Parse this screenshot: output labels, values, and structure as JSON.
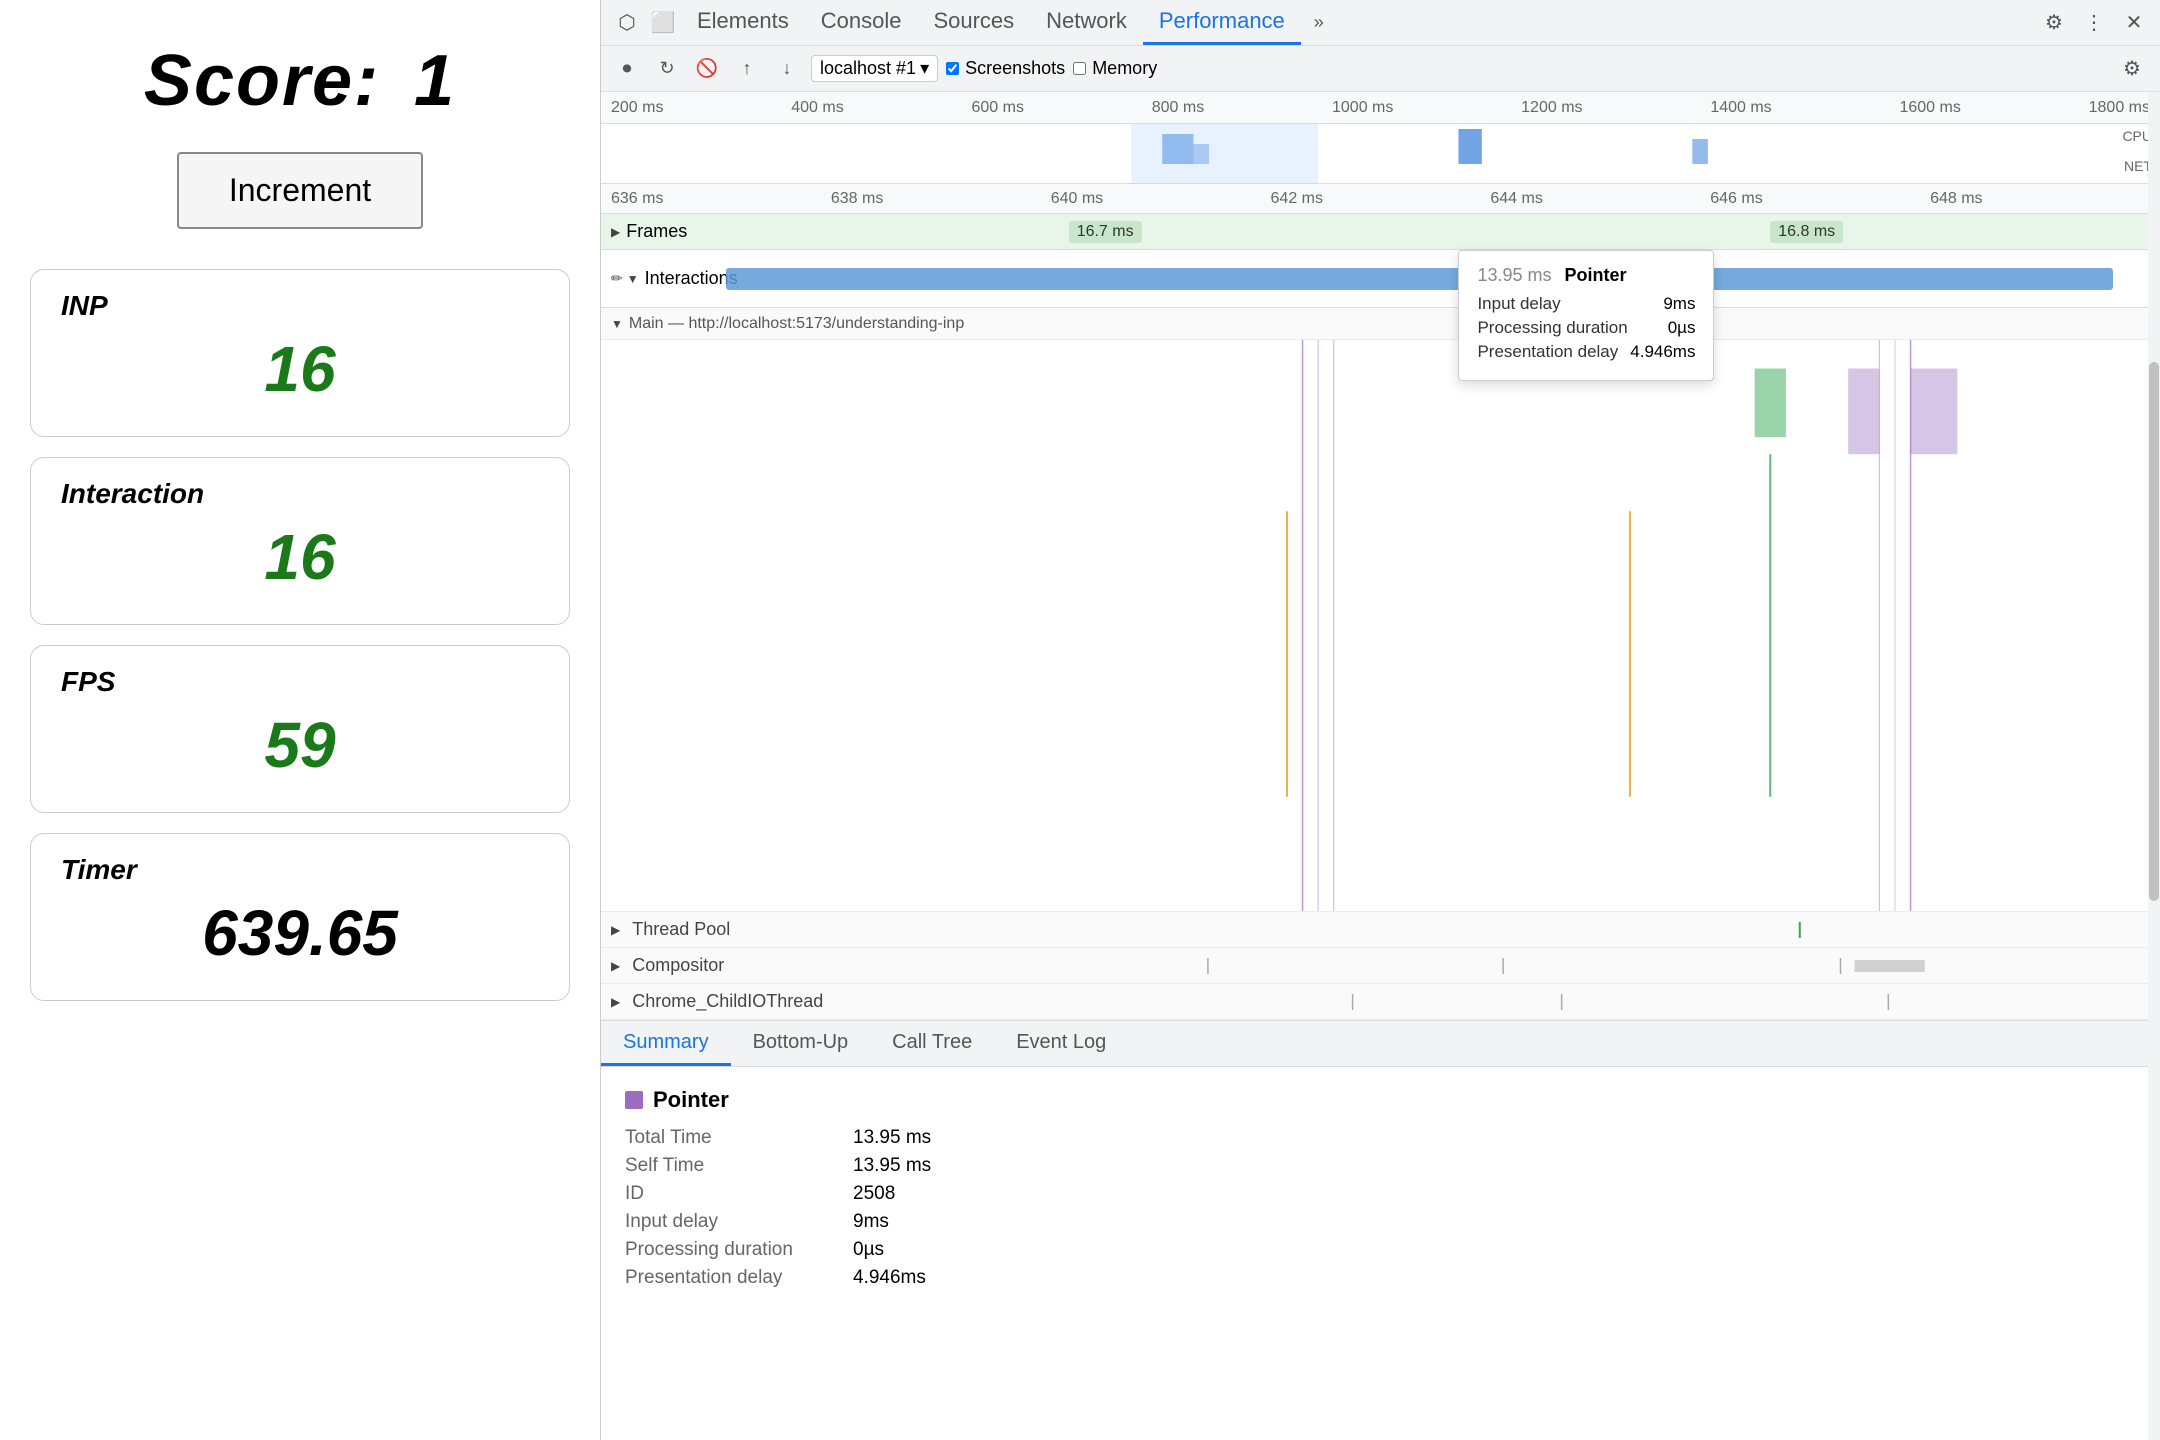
{
  "left": {
    "score_label": "Score:",
    "score_value": "1",
    "increment_btn": "Increment",
    "metrics": [
      {
        "id": "inp",
        "label": "INP",
        "value": "16",
        "color": "green"
      },
      {
        "id": "interaction",
        "label": "Interaction",
        "value": "16",
        "color": "green"
      },
      {
        "id": "fps",
        "label": "FPS",
        "value": "59",
        "color": "green"
      },
      {
        "id": "timer",
        "label": "Timer",
        "value": "639.65",
        "color": "black"
      }
    ]
  },
  "devtools": {
    "tabs": [
      {
        "id": "elements",
        "label": "Elements"
      },
      {
        "id": "console",
        "label": "Console"
      },
      {
        "id": "sources",
        "label": "Sources"
      },
      {
        "id": "network",
        "label": "Network"
      },
      {
        "id": "performance",
        "label": "Performance",
        "active": true
      }
    ],
    "toolbar": {
      "record_title": "Record",
      "reload_title": "Reload",
      "clear_title": "Clear",
      "upload_title": "Upload",
      "download_title": "Download",
      "source": "localhost #1",
      "screenshots_label": "Screenshots",
      "memory_label": "Memory",
      "screenshots_checked": true,
      "memory_checked": false
    },
    "time_rulers": {
      "overview": [
        "200 ms",
        "400 ms",
        "600 ms",
        "800 ms",
        "1000 ms",
        "1200 ms",
        "1400 ms",
        "1600 ms",
        "1800 ms"
      ],
      "zoomed": [
        "636 ms",
        "638 ms",
        "640 ms",
        "642 ms",
        "644 ms",
        "646 ms",
        "648 ms"
      ]
    },
    "cpu_label": "CPU",
    "net_label": "NET",
    "frames": {
      "label": "Frames",
      "badge1": "16.7 ms",
      "badge2": "16.8 ms"
    },
    "interactions": {
      "label": "Interactions"
    },
    "tooltip": {
      "time": "13.95 ms",
      "type": "Pointer",
      "input_delay_label": "Input delay",
      "input_delay_value": "9ms",
      "processing_label": "Processing duration",
      "processing_value": "0µs",
      "presentation_label": "Presentation delay",
      "presentation_value": "4.946ms"
    },
    "main_thread": {
      "label": "Main — http://localhost:5173/understanding-inp"
    },
    "tracks": [
      {
        "id": "thread-pool",
        "label": "Thread Pool"
      },
      {
        "id": "compositor",
        "label": "Compositor"
      },
      {
        "id": "chrome-io",
        "label": "Chrome_ChildIOThread"
      }
    ],
    "summary": {
      "tabs": [
        {
          "id": "summary",
          "label": "Summary",
          "active": true
        },
        {
          "id": "bottom-up",
          "label": "Bottom-Up"
        },
        {
          "id": "call-tree",
          "label": "Call Tree"
        },
        {
          "id": "event-log",
          "label": "Event Log"
        }
      ],
      "pointer_label": "Pointer",
      "fields": [
        {
          "key": "Total Time",
          "value": "13.95 ms"
        },
        {
          "key": "Self Time",
          "value": "13.95 ms"
        },
        {
          "key": "ID",
          "value": "2508"
        },
        {
          "key": "Input delay",
          "value": "9ms"
        },
        {
          "key": "Processing duration",
          "value": "0µs"
        },
        {
          "key": "Presentation delay",
          "value": "4.946ms"
        }
      ]
    }
  }
}
